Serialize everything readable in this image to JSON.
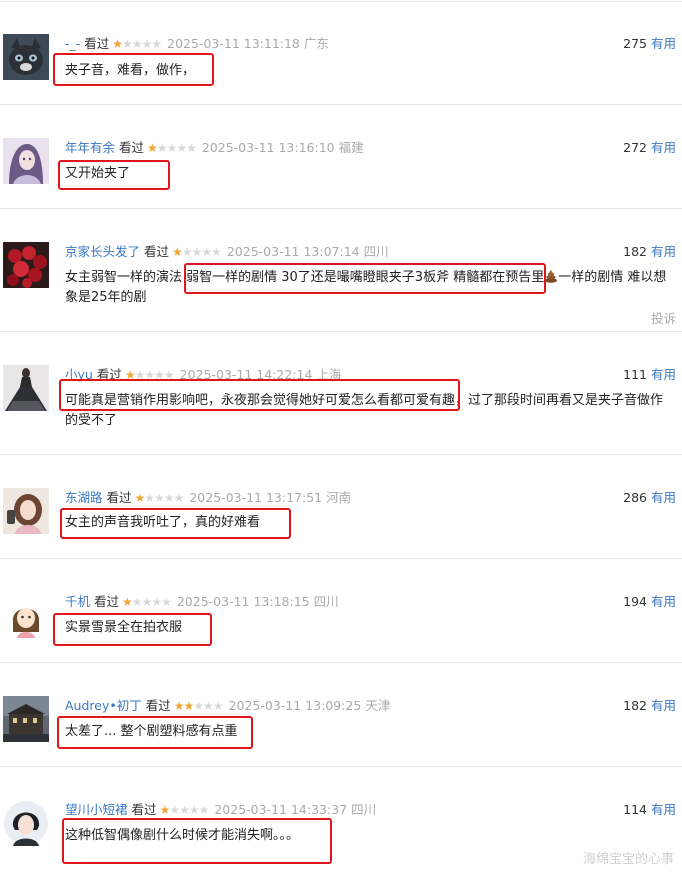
{
  "watermark": "海绵宝宝的心事",
  "comments": [
    {
      "user": "-_-",
      "seen": "看过",
      "rating": 1,
      "time": "2025-03-11 13:11:18",
      "location": "广东",
      "votes": "275",
      "vote_label": "有用",
      "text": "夹子音，难看，做作，",
      "avatar": "cat-avatar"
    },
    {
      "user": "年年有余",
      "seen": "看过",
      "rating": 1,
      "time": "2025-03-11 13:16:10",
      "location": "福建",
      "votes": "272",
      "vote_label": "有用",
      "text": "又开始夹了",
      "avatar": "anime-girl-avatar"
    },
    {
      "user": "京家长头发了",
      "seen": "看过",
      "rating": 1,
      "time": "2025-03-11 13:07:14",
      "location": "四川",
      "votes": "182",
      "vote_label": "有用",
      "text_a": "女主弱智一样的演法 弱智一样的剧情 30了还是嘬嘴瞪眼夹子3板斧 精髓都在预告里",
      "text_b": "一样的剧情 难以想象是25年的剧",
      "report": "投诉",
      "avatar": "roses-avatar"
    },
    {
      "user": "小yu",
      "seen": "看过",
      "rating": 1,
      "time": "2025-03-11 14:22:14",
      "location": "上海",
      "votes": "111",
      "vote_label": "有用",
      "text": "可能真是营销作用影响吧，永夜那会觉得她好可爱怎么看都可爱有趣，过了那段时间再看又是夹子音做作的受不了",
      "avatar": "gown-avatar"
    },
    {
      "user": "东湖路",
      "seen": "看过",
      "rating": 1,
      "time": "2025-03-11 13:17:51",
      "location": "河南",
      "votes": "286",
      "vote_label": "有用",
      "text": "女主的声音我听吐了，真的好难看",
      "avatar": "selfie-avatar"
    },
    {
      "user": "千机",
      "seen": "看过",
      "rating": 1,
      "time": "2025-03-11 13:18:15",
      "location": "四川",
      "votes": "194",
      "vote_label": "有用",
      "text": "实景雪景全在拍衣服",
      "avatar": "cartoon-girl-avatar"
    },
    {
      "user": "Audrey•初丁",
      "seen": "看过",
      "rating": 2,
      "time": "2025-03-11 13:09:25",
      "location": "天津",
      "votes": "182",
      "vote_label": "有用",
      "text": "太差了... 整个剧塑料感有点重",
      "avatar": "building-avatar"
    },
    {
      "user": "望川小短裙",
      "seen": "看过",
      "rating": 1,
      "time": "2025-03-11 14:33:37",
      "location": "四川",
      "votes": "114",
      "vote_label": "有用",
      "text": "这种低智偶像剧什么时候才能消失啊。。。",
      "avatar": "portrait-avatar"
    }
  ]
}
